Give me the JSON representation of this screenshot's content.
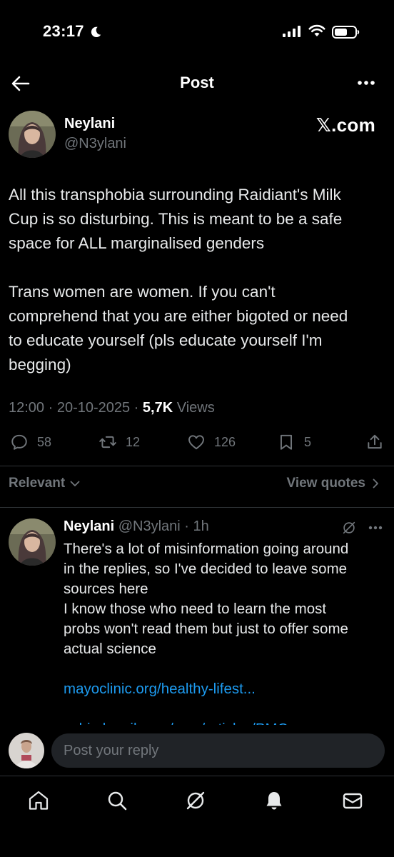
{
  "status_bar": {
    "time": "23:17",
    "icons": [
      "moon-icon",
      "signal-icon",
      "wifi-icon",
      "battery-icon"
    ]
  },
  "header": {
    "title": "Post",
    "icons": [
      "back-arrow-icon",
      "more-icon"
    ]
  },
  "post": {
    "author_name": "Neylani",
    "author_handle": "@N3ylani",
    "watermark": "𝕏.com",
    "body_lines": [
      "All this transphobia surrounding Raidiant's Milk",
      "Cup is so disturbing. This is meant to be a safe",
      "space for ALL marginalised genders",
      "",
      "Trans women are women. If you can't",
      "comprehend that you are either bigoted or need",
      "to educate yourself (pls educate yourself I'm",
      "begging)"
    ],
    "timestamp": "12:00 · 20-10-2025 · ",
    "views_count": "5,7K",
    "views_label": " Views",
    "actions": {
      "replies": "58",
      "reposts": "12",
      "likes": "126",
      "bookmarks": "5"
    }
  },
  "replies_filter": {
    "sort_label": "Relevant",
    "quotes_label": "View quotes"
  },
  "reply": {
    "author_name": "Neylani",
    "author_handle": "@N3ylani",
    "separator": " · ",
    "time": "1h",
    "body_lines": [
      "There's a lot of misinformation going around",
      "in the replies, so I've decided to leave some",
      "sources here",
      "I know those who need to learn the most",
      "probs won't read them but just to offer some",
      "actual science",
      ""
    ],
    "link": "mayoclinic.org/healthy-lifest...",
    "partial_link": "ncbi.nlm.nih.gov/pmc/articles/PMC"
  },
  "composer": {
    "placeholder": "Post your reply"
  },
  "bottom_nav": {
    "items": [
      "home-icon",
      "search-icon",
      "grok-icon",
      "notifications-icon",
      "messages-icon"
    ]
  },
  "colors": {
    "background": "#000000",
    "text": "#e7e9ea",
    "muted": "#71767b",
    "link": "#1d9bf0",
    "divider": "#2f3336",
    "input_bg": "#202327"
  }
}
